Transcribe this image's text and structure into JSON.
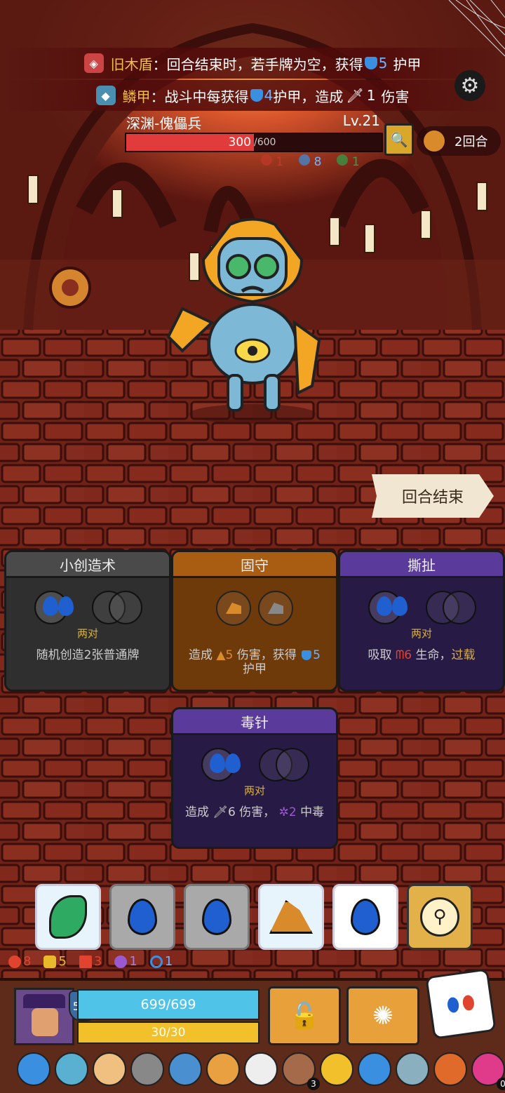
{
  "buffs": [
    {
      "name": "旧木盾",
      "text_a": "：回合结束时，若手牌为空，获得",
      "value": "5",
      "text_b": "护甲"
    },
    {
      "name": "鳞甲",
      "text_a": "：战斗中每获得",
      "value": "4",
      "text_b": "护甲，造成",
      "value2": "1",
      "text_c": "伤害"
    }
  ],
  "enemy": {
    "name": "深渊-傀儡兵",
    "level": "Lv.21",
    "hp": "300",
    "hp_max": "/600",
    "hp_fraction": 0.5,
    "effects": [
      {
        "icon": "attack-icon",
        "value": "1",
        "color": "#c0392b"
      },
      {
        "icon": "gear-icon",
        "value": "8",
        "color": "#3a8fe0"
      },
      {
        "icon": "swirl-icon",
        "value": "1",
        "color": "#2ea34a"
      }
    ]
  },
  "turn": "2回合",
  "end_turn_button": "回合结束",
  "cards": [
    {
      "title": "小创造术",
      "pair": "两对",
      "desc": "随机创造2张普通牌",
      "color": "#3b3b3b"
    },
    {
      "title": "固守",
      "pair": "",
      "desc_a": "造成",
      "desc_v1": "5",
      "desc_b": "伤害，获得",
      "desc_v2": "5",
      "desc_c": "护甲",
      "color": "#8a4a0d"
    },
    {
      "title": "撕扯",
      "pair": "两对",
      "desc_a": "吸取",
      "desc_v1": "6",
      "desc_b": "生命，",
      "desc_c": "过载",
      "color": "#3b2570"
    },
    {
      "title": "毒针",
      "pair": "两对",
      "desc_a": "造成",
      "desc_v1": "6",
      "desc_b": "伤害，",
      "desc_v2": "2",
      "desc_c": "中毒",
      "color": "#3b2570"
    }
  ],
  "dice": [
    {
      "icon": "leaf-die-icon",
      "frozen": true
    },
    {
      "icon": "water-die-icon",
      "frozen": false
    },
    {
      "icon": "water-die-icon",
      "frozen": false
    },
    {
      "icon": "rock-die-icon",
      "frozen": true
    },
    {
      "icon": "water-die-icon",
      "frozen": false
    },
    {
      "icon": "locked-chest-icon",
      "frozen": false
    }
  ],
  "player_stats": [
    {
      "icon": "strength-icon",
      "value": "8",
      "color": "#e0442f"
    },
    {
      "icon": "shield-icon",
      "value": "5",
      "color": "#e8b92a"
    },
    {
      "icon": "fire-icon",
      "value": "3",
      "color": "#e0442f"
    },
    {
      "icon": "splash-icon",
      "value": "1",
      "color": "#9b59d0"
    },
    {
      "icon": "spiral-icon",
      "value": "1",
      "color": "#3a8fe0"
    }
  ],
  "player": {
    "armor": "563",
    "hp": "699/699",
    "hp_fraction": 1.0,
    "energy": "30/30",
    "energy_fraction": 1.0
  },
  "relic_badges": {
    "a": "3",
    "b": "0"
  }
}
